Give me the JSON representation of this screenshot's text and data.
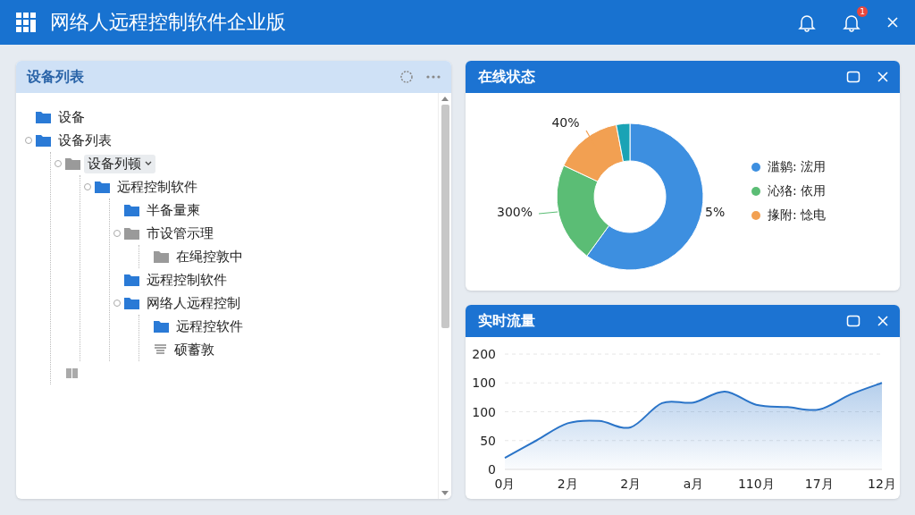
{
  "window": {
    "title": "网络人远程控制软件企业版",
    "notification_badge": "1"
  },
  "device_panel": {
    "title": "设备列表",
    "tree": [
      {
        "label": "设备",
        "kind": "folder",
        "color": "#2a7ad6",
        "selected": false
      },
      {
        "label": "设备列表",
        "kind": "folder",
        "color": "#2a7ad6",
        "selected": false,
        "children": [
          {
            "label": "设备列顿",
            "kind": "folder",
            "color": "#9a9a9a",
            "selected": true,
            "children": [
              {
                "label": "远程控制软件",
                "kind": "folder",
                "color": "#2a7ad6",
                "selected": false,
                "children": [
                  {
                    "label": "半备量柬",
                    "kind": "folder",
                    "color": "#2a7ad6",
                    "selected": false
                  },
                  {
                    "label": "市设管示理",
                    "kind": "folder",
                    "color": "#9a9a9a",
                    "selected": false,
                    "children": [
                      {
                        "label": "在绳控敦中",
                        "kind": "folder",
                        "color": "#9a9a9a",
                        "selected": false
                      }
                    ]
                  },
                  {
                    "label": "远程控制软件",
                    "kind": "folder",
                    "color": "#2a7ad6",
                    "selected": false
                  },
                  {
                    "label": "网络人远程控制",
                    "kind": "folder",
                    "color": "#2a7ad6",
                    "selected": false,
                    "children": [
                      {
                        "label": "远程控软件",
                        "kind": "folder",
                        "color": "#2a7ad6",
                        "selected": false
                      },
                      {
                        "label": "硕蓄敦",
                        "kind": "document",
                        "selected": false
                      }
                    ]
                  }
                ]
              }
            ]
          },
          {
            "kind": "book",
            "selected": false
          }
        ]
      }
    ]
  },
  "status_panel": {
    "title": "在线状态",
    "value_labels": [
      "5%",
      "300%",
      "40%"
    ],
    "legend": [
      {
        "label": "滥鹟: 浤用",
        "color": "#3d8fe0"
      },
      {
        "label": "沁狢: 依用",
        "color": "#5bbd75"
      },
      {
        "label": "掾附: 惗电",
        "color": "#f2a052"
      }
    ]
  },
  "traffic_panel": {
    "title": "实时流量",
    "y_axis_labels": [
      "200",
      "100",
      "100",
      "50",
      "0"
    ],
    "x_axis_labels": [
      "0月",
      "2月",
      "2月",
      "a月",
      "110月",
      "17月",
      "12月"
    ]
  }
}
